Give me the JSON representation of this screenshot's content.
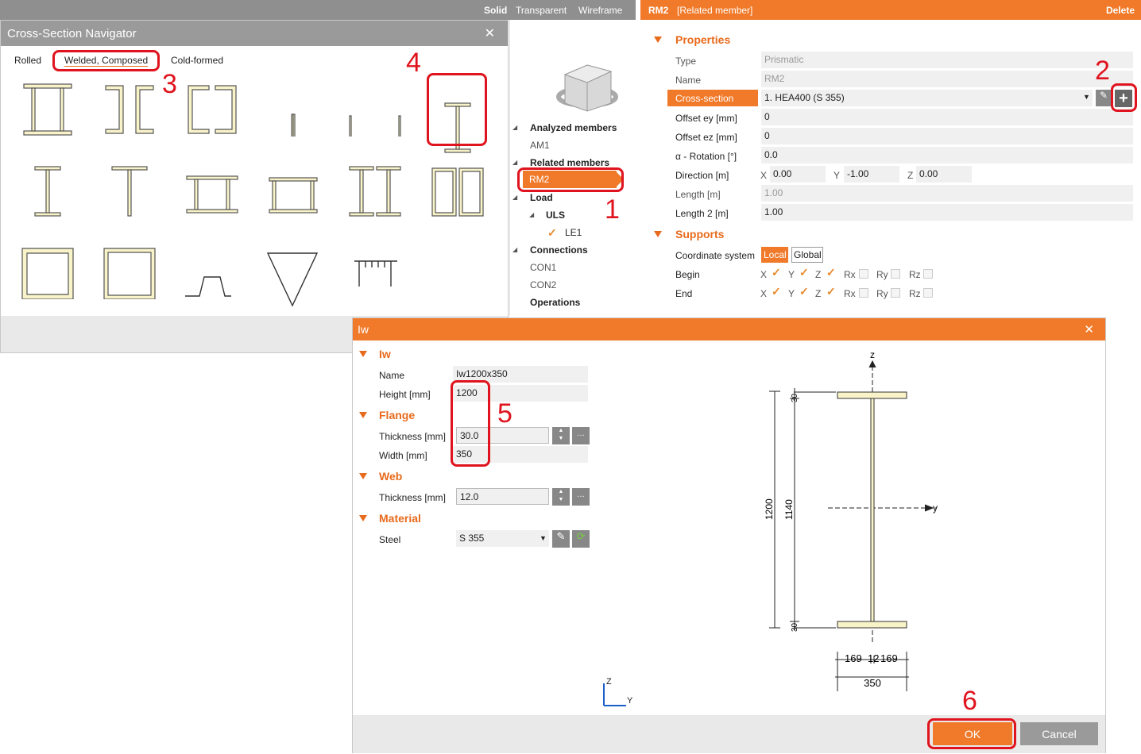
{
  "viewbar": {
    "solid": "Solid",
    "transparent": "Transparent",
    "wireframe": "Wireframe"
  },
  "navigator": {
    "title": "Cross-Section Navigator",
    "tabs": [
      "Rolled",
      "Welded, Composed",
      "Cold-formed"
    ]
  },
  "tree": {
    "analyzed_members": "Analyzed members",
    "am1": "AM1",
    "related_members": "Related members",
    "rm2": "RM2",
    "load": "Load",
    "uls": "ULS",
    "le1": "LE1",
    "connections": "Connections",
    "con1": "CON1",
    "con2": "CON2",
    "operations": "Operations"
  },
  "member": {
    "name": "RM2",
    "subtitle": "[Related member]",
    "delete": "Delete",
    "properties": "Properties",
    "type_label": "Type",
    "type_value": "Prismatic",
    "name_label": "Name",
    "name_value": "RM2",
    "cs_label": "Cross-section",
    "cs_value": "1. HEA400 (S 355)",
    "ey_label": "Offset ey [mm]",
    "ey_value": "0",
    "ez_label": "Offset ez [mm]",
    "ez_value": "0",
    "rot_label": "α - Rotation [°]",
    "rot_value": "0.0",
    "dir_label": "Direction [m]",
    "dir_x_label": "X",
    "dir_x": "0.00",
    "dir_y_label": "Y",
    "dir_y": "-1.00",
    "dir_z_label": "Z",
    "dir_z": "0.00",
    "len_label": "Length [m]",
    "len_value": "1.00",
    "len2_label": "Length 2 [m]",
    "len2_value": "1.00",
    "supports": "Supports",
    "coord_label": "Coordinate system",
    "coord_local": "Local",
    "coord_global": "Global",
    "begin_label": "Begin",
    "end_label": "End",
    "dof": [
      "X",
      "Y",
      "Z",
      "Rx",
      "Ry",
      "Rz"
    ]
  },
  "dialog": {
    "title": "Iw",
    "section_iw": "Iw",
    "name_label": "Name",
    "name_value": "Iw1200x350",
    "height_label": "Height [mm]",
    "height_value": "1200",
    "flange": "Flange",
    "fl_thk_label": "Thickness [mm]",
    "fl_thk_value": "30.0",
    "fl_w_label": "Width [mm]",
    "fl_w_value": "350",
    "web": "Web",
    "web_thk_label": "Thickness [mm]",
    "web_thk_value": "12.0",
    "material": "Material",
    "steel_label": "Steel",
    "steel_value": "S 355",
    "ok": "OK",
    "cancel": "Cancel",
    "drawing": {
      "z": "z",
      "y": "y",
      "h": "1200",
      "hw": "1140",
      "tf_top": "30",
      "tf_bot": "30",
      "b1": "169",
      "tw": "12",
      "b2": "169",
      "b": "350",
      "ax_z": "Z",
      "ax_y": "Y"
    }
  },
  "annotations": [
    "1",
    "2",
    "3",
    "4",
    "5",
    "6"
  ],
  "colors": {
    "accent": "#f07a2a",
    "highlight": "#e0141e",
    "section_fill": "#f8f3c8"
  }
}
